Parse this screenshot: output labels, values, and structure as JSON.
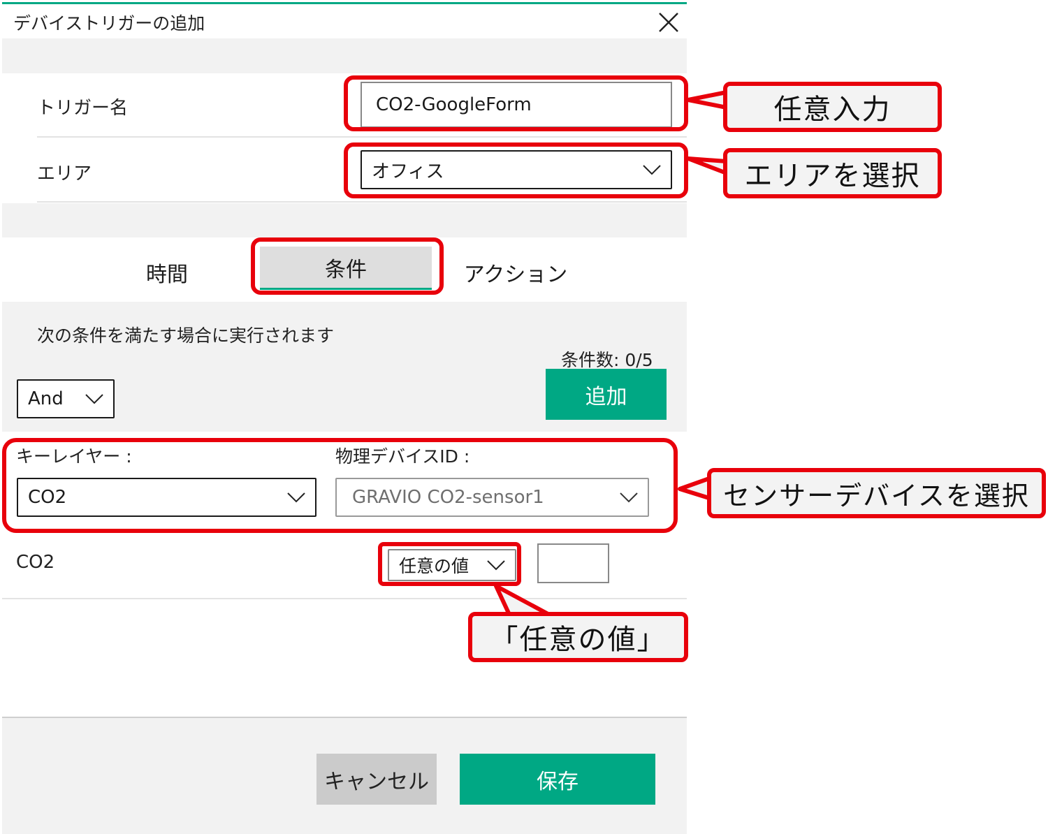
{
  "dialog": {
    "title": "デバイストリガーの追加",
    "accent_color": "#00a884"
  },
  "fields": {
    "trigger_name_label": "トリガー名",
    "trigger_name_value": "CO2-GoogleForm",
    "area_label": "エリア",
    "area_value": "オフィス"
  },
  "tabs": [
    {
      "label": "時間"
    },
    {
      "label": "条件"
    },
    {
      "label": "アクション"
    }
  ],
  "conditions": {
    "description": "次の条件を満たす場合に実行されます",
    "count_text": "条件数: 0/5",
    "logic_value": "And",
    "add_label": "追加",
    "key_layer_label": "キーレイヤー :",
    "key_layer_value": "CO2",
    "device_id_label": "物理デバイスID :",
    "device_id_value": "GRAVIO CO2-sensor1",
    "row_label": "CO2",
    "operator_value": "任意の値",
    "value_input": ""
  },
  "footer": {
    "cancel_label": "キャンセル",
    "save_label": "保存"
  },
  "annotations": {
    "free_input": "任意入力",
    "select_area": "エリアを選択",
    "select_sensor": "センサーデバイスを選択",
    "any_value": "「任意の値」",
    "highlight_color": "#e8000b"
  }
}
